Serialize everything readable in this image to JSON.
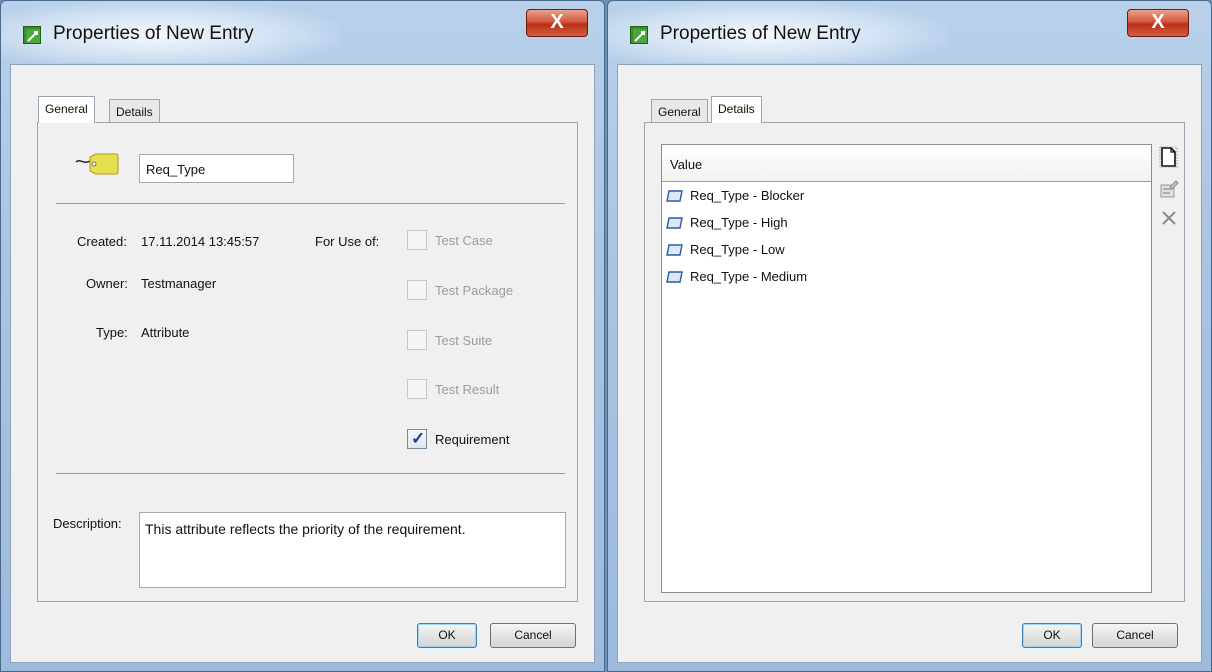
{
  "left_dialog": {
    "title": "Properties of New Entry",
    "close_label": "X",
    "tabs": [
      "General",
      "Details"
    ],
    "active_tab": "General",
    "name_value": "Req_Type",
    "created_label": "Created:",
    "created_value": "17.11.2014 13:45:57",
    "owner_label": "Owner:",
    "owner_value": "Testmanager",
    "type_label": "Type:",
    "type_value": "Attribute",
    "for_use_label": "For Use of:",
    "checkboxes": [
      {
        "label": "Test Case",
        "checked": false
      },
      {
        "label": "Test Package",
        "checked": false
      },
      {
        "label": "Test Suite",
        "checked": false
      },
      {
        "label": "Test Result",
        "checked": false
      },
      {
        "label": "Requirement",
        "checked": true
      }
    ],
    "description_label": "Description:",
    "description_value": "This attribute reflects the priority of the requirement.",
    "ok_label": "OK",
    "cancel_label": "Cancel"
  },
  "right_dialog": {
    "title": "Properties of New Entry",
    "close_label": "X",
    "tabs": [
      "General",
      "Details"
    ],
    "active_tab": "Details",
    "column_header": "Value",
    "values": [
      "Req_Type - Blocker",
      "Req_Type - High",
      "Req_Type - Low",
      "Req_Type - Medium"
    ],
    "toolbar_icons": [
      "new-document-icon",
      "edit-properties-icon",
      "delete-x-icon"
    ],
    "ok_label": "OK",
    "cancel_label": "Cancel"
  },
  "colors": {
    "title_bar": "#a9c4e2",
    "close_button": "#c8442a",
    "client_bg": "#f0f0f0",
    "tag_icon": "#e6df4f",
    "checkmark": "#1a3f8a"
  }
}
